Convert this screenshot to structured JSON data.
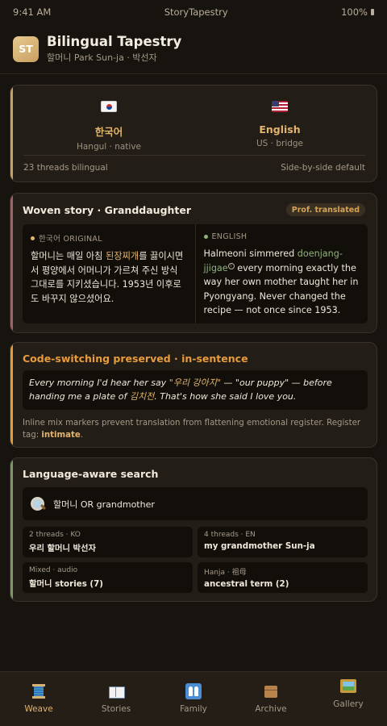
{
  "status_bar": {
    "time": "9:41 AM",
    "app_name": "StoryTapestry",
    "battery": "100%"
  },
  "header": {
    "avatar_initials": "ST",
    "title": "Bilingual Tapestry",
    "subtitle": "할머니 Park Sun-ja · 박선자"
  },
  "languages": {
    "items": [
      {
        "flag": "south-korea-flag",
        "name": "한국어",
        "sub": "Hangul · native"
      },
      {
        "flag": "us-flag",
        "name": "English",
        "sub": "US · bridge"
      }
    ],
    "footer_left": "23 threads bilingual",
    "footer_right": "Side-by-side default",
    "accent_color": "#c9a061"
  },
  "woven_story": {
    "title": "Woven story · Granddaughter",
    "badge": "Prof. translated",
    "accent_color": "#a35f6a",
    "korean": {
      "label": "한국어 ORIGINAL",
      "text_before": "할머니는 매일 아침 ",
      "text_highlight": "된장찌개",
      "text_after": "를 끓이시면서 평양에서 어머니가 가르쳐 주신 방식 그대로를 지키셨습니다. 1953년 이후로도 바꾸지 않으셨어요."
    },
    "english": {
      "label": "ENGLISH",
      "text_before": "Halmeoni simmered ",
      "text_highlight": "doenjang-jjigae",
      "note_marker": "i",
      "text_after": " every morning exactly the way her own mother taught her in Pyongyang. Never changed the recipe — not once since 1953."
    }
  },
  "code_switching": {
    "title": "Code-switching preserved · in-sentence",
    "accent_color": "#e89b3a",
    "quote_part1": "Every morning I'd hear her say ",
    "quote_hl1": "\"우리 강아지\"",
    "quote_part2": " — \"our puppy\" — before handing me a plate of ",
    "quote_hl2": "김치전",
    "quote_part3": ". That's how she said I love you.",
    "note": "Inline mix markers prevent translation from flattening emotional register. Register tag: ",
    "register_tag": "intimate",
    "note_end": "."
  },
  "search": {
    "title": "Language-aware search",
    "accent_color": "#7a9a6a",
    "query": "할머니 OR grandmother",
    "results": [
      {
        "meta": "2 threads · KO",
        "label": "우리 할머니 박선자"
      },
      {
        "meta": "4 threads · EN",
        "label": "my grandmother Sun-ja"
      },
      {
        "meta": "Mixed · audio",
        "label": "할머니 stories (7)"
      },
      {
        "meta": "Hanja · 祖母",
        "label": "ancestral term (2)"
      }
    ]
  },
  "tabbar": {
    "tabs": [
      {
        "icon": "spool-of-thread-icon",
        "label": "Weave",
        "active": true
      },
      {
        "icon": "open-book-icon",
        "label": "Stories",
        "active": false
      },
      {
        "icon": "family-icon",
        "label": "Family",
        "active": false
      },
      {
        "icon": "package-box-icon",
        "label": "Archive",
        "active": false
      },
      {
        "icon": "framed-picture-icon",
        "label": "Gallery",
        "active": false
      }
    ]
  }
}
